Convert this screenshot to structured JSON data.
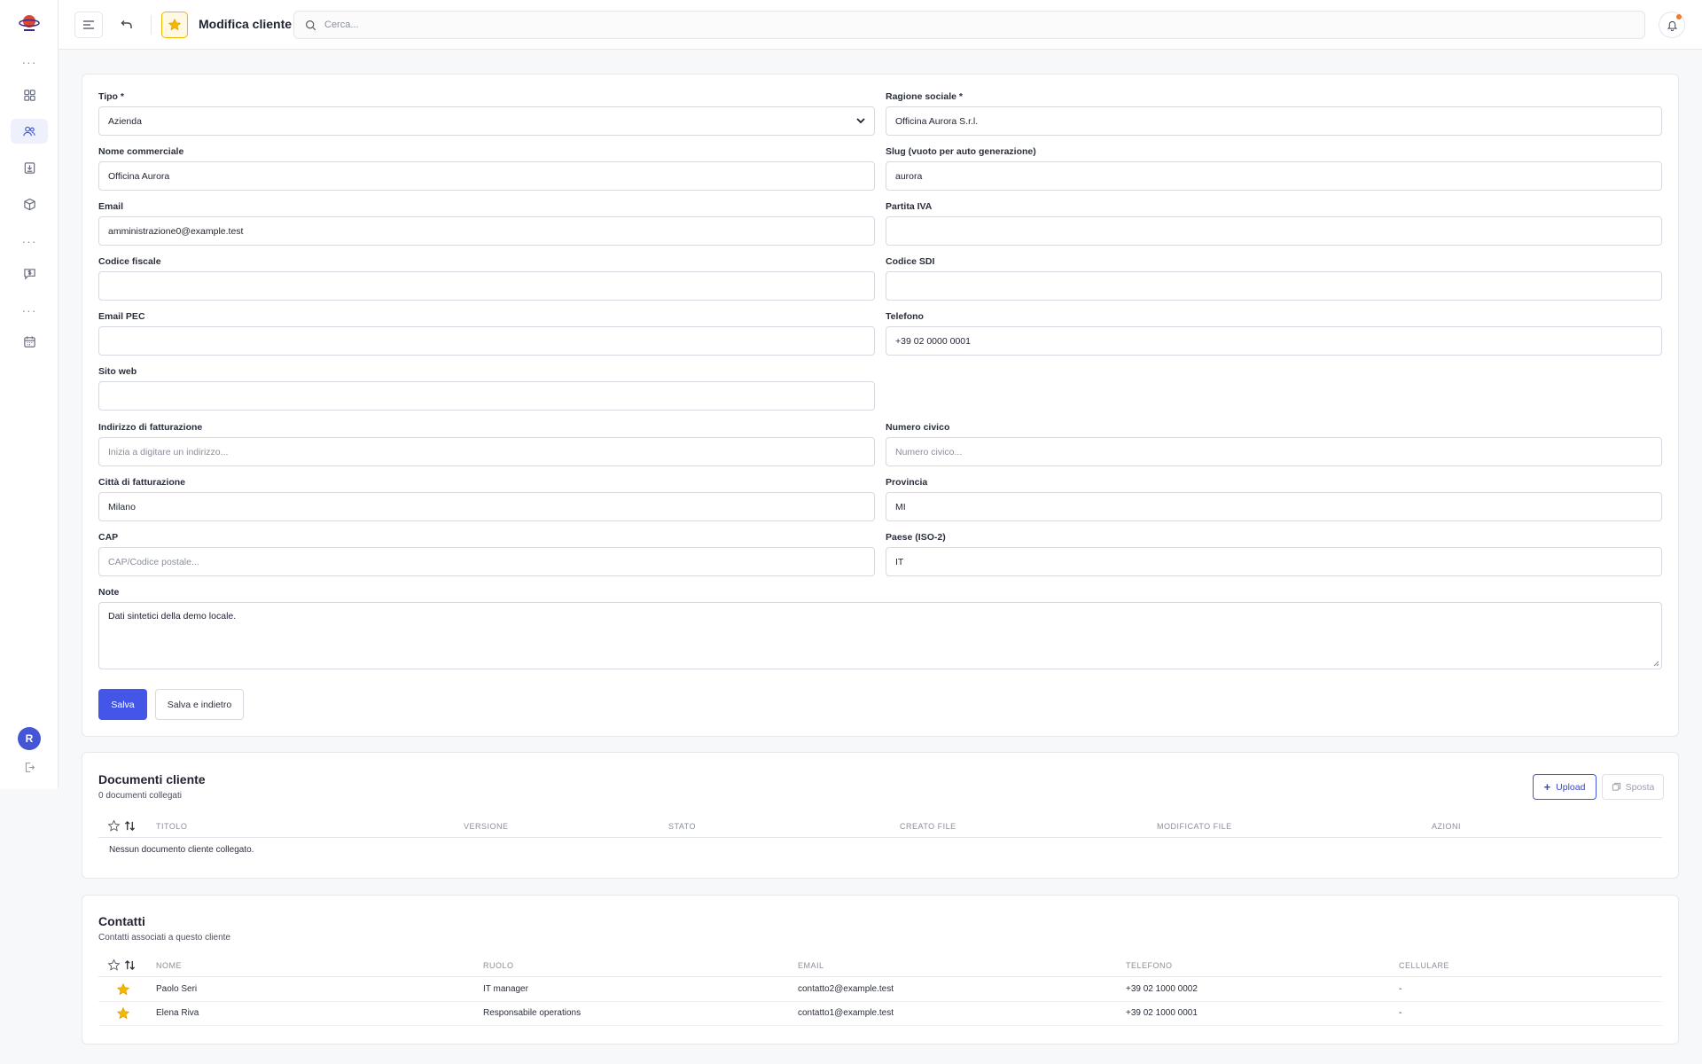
{
  "app": {
    "colors": {
      "accent": "#4456e8",
      "star": "#f5b800",
      "notification": "#f07b2a"
    }
  },
  "topbar": {
    "title": "Modifica cliente",
    "search_placeholder": "Cerca..."
  },
  "sidebar": {
    "avatar_initial": "R"
  },
  "form": {
    "tipo": {
      "label": "Tipo *",
      "value": "Azienda"
    },
    "ragione_sociale": {
      "label": "Ragione sociale *",
      "value": "Officina Aurora S.r.l."
    },
    "nome_commerciale": {
      "label": "Nome commerciale",
      "value": "Officina Aurora"
    },
    "slug": {
      "label": "Slug (vuoto per auto generazione)",
      "value": "aurora"
    },
    "email": {
      "label": "Email",
      "value": "amministrazione0@example.test"
    },
    "partita_iva": {
      "label": "Partita IVA",
      "value": ""
    },
    "codice_fiscale": {
      "label": "Codice fiscale",
      "value": ""
    },
    "codice_sdi": {
      "label": "Codice SDI",
      "value": ""
    },
    "email_pec": {
      "label": "Email PEC",
      "value": ""
    },
    "telefono": {
      "label": "Telefono",
      "value": "+39 02 0000 0001"
    },
    "sito_web": {
      "label": "Sito web",
      "value": ""
    },
    "indirizzo": {
      "label": "Indirizzo di fatturazione",
      "value": "",
      "placeholder": "Inizia a digitare un indirizzo..."
    },
    "numero_civico": {
      "label": "Numero civico",
      "value": "",
      "placeholder": "Numero civico..."
    },
    "citta": {
      "label": "Città di fatturazione",
      "value": "Milano"
    },
    "provincia": {
      "label": "Provincia",
      "value": "MI"
    },
    "cap": {
      "label": "CAP",
      "value": "",
      "placeholder": "CAP/Codice postale..."
    },
    "paese": {
      "label": "Paese (ISO-2)",
      "value": "IT"
    },
    "note": {
      "label": "Note",
      "value": "Dati sintetici della demo locale."
    },
    "save_label": "Salva",
    "save_back_label": "Salva e indietro"
  },
  "documents": {
    "title": "Documenti cliente",
    "subtitle": "0 documenti collegati",
    "upload_label": "Upload",
    "move_label": "Sposta",
    "columns": [
      "Titolo",
      "Versione",
      "Stato",
      "Creato file",
      "Modificato file",
      "Azioni"
    ],
    "empty_text": "Nessun documento cliente collegato."
  },
  "contacts": {
    "title": "Contatti",
    "subtitle": "Contatti associati a questo cliente",
    "columns": [
      "Nome",
      "Ruolo",
      "Email",
      "Telefono",
      "Cellulare"
    ],
    "rows": [
      {
        "nome": "Paolo Seri",
        "ruolo": "IT manager",
        "email": "contatto2@example.test",
        "telefono": "+39 02 1000 0002",
        "cellulare": "-"
      },
      {
        "nome": "Elena Riva",
        "ruolo": "Responsabile operations",
        "email": "contatto1@example.test",
        "telefono": "+39 02 1000 0001",
        "cellulare": "-"
      }
    ]
  }
}
